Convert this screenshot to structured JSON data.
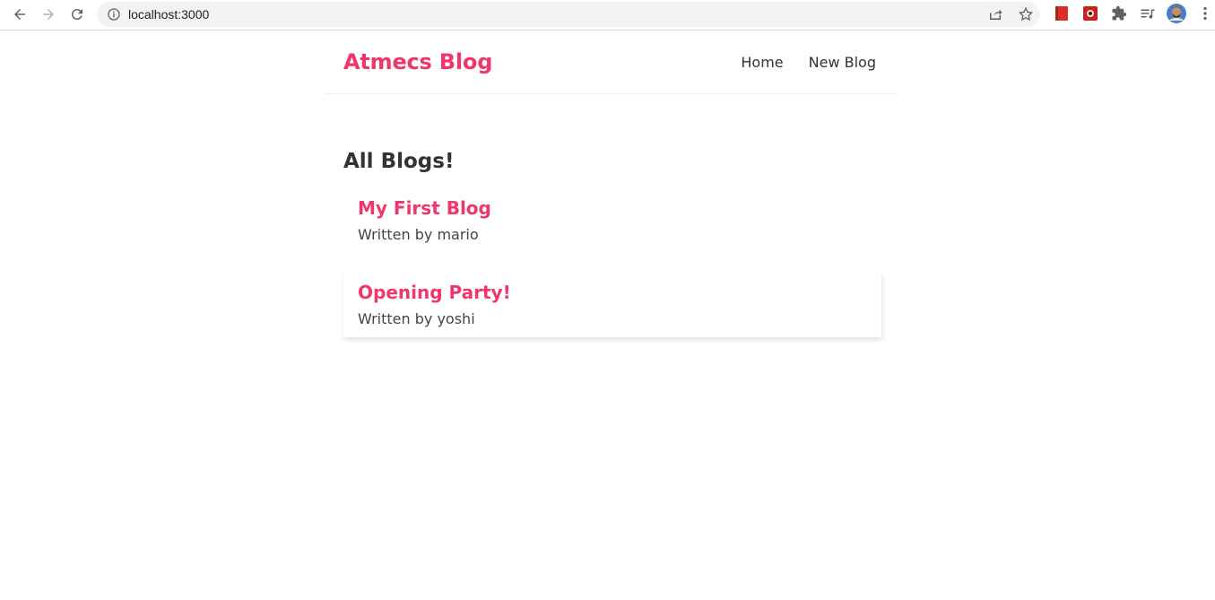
{
  "browser": {
    "url": "localhost:3000"
  },
  "navbar": {
    "brand": "Atmecs Blog",
    "links": [
      {
        "label": "Home"
      },
      {
        "label": "New Blog"
      }
    ]
  },
  "main": {
    "heading": "All Blogs!",
    "blogs": [
      {
        "title": "My First Blog",
        "author_line": "Written by mario"
      },
      {
        "title": "Opening Party!",
        "author_line": "Written by yoshi"
      }
    ]
  },
  "colors": {
    "accent": "#f1356d",
    "text": "#333333"
  }
}
